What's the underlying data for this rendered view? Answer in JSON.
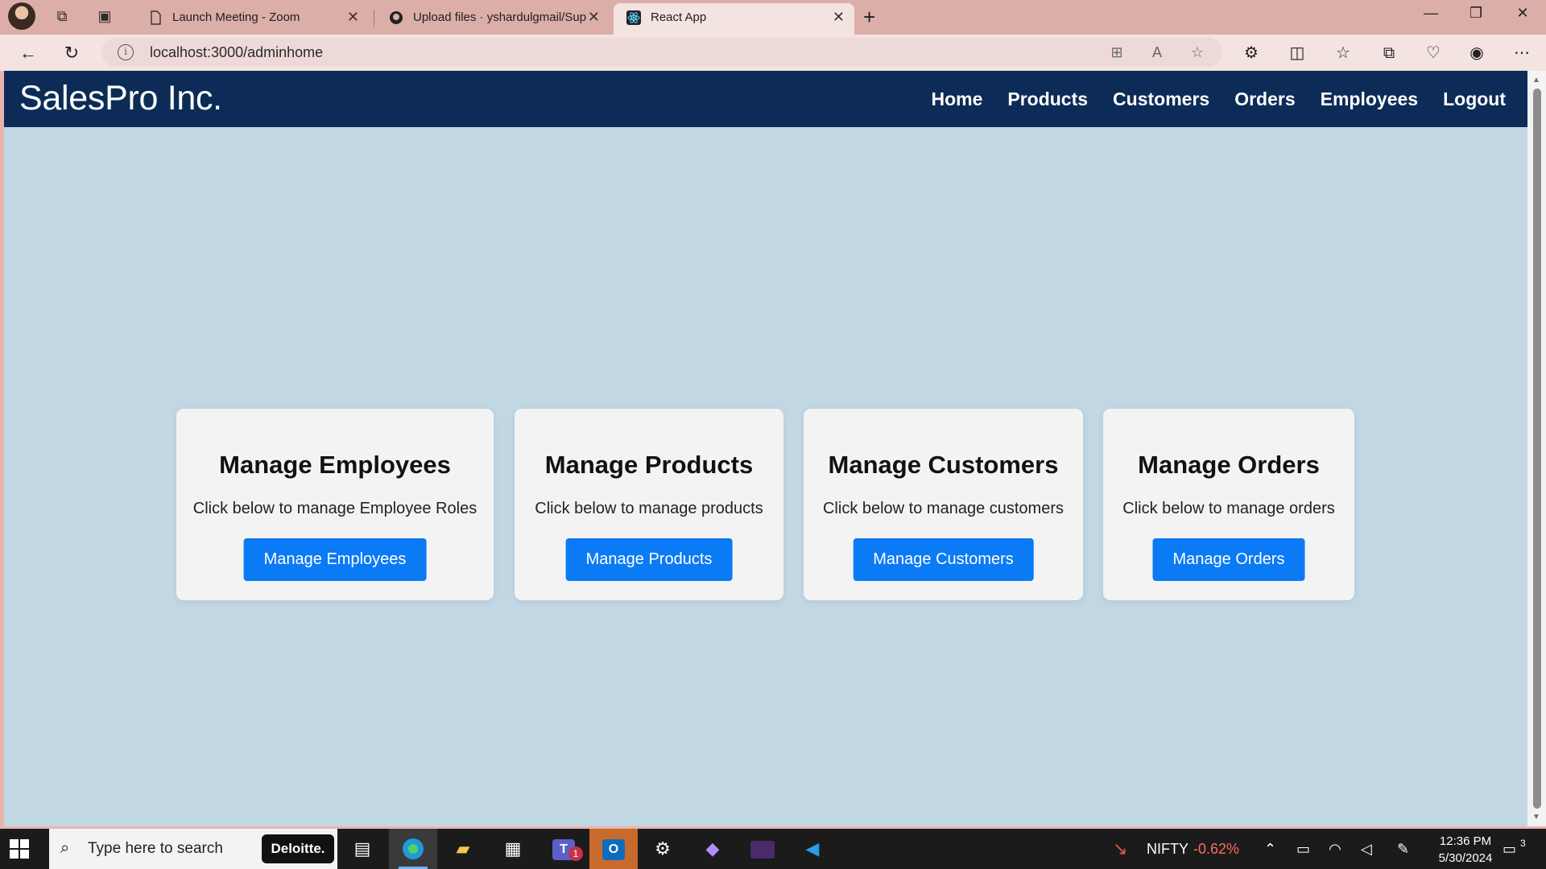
{
  "browser": {
    "tabs": [
      {
        "title": "Launch Meeting - Zoom",
        "icon": "document-icon",
        "active": false
      },
      {
        "title": "Upload files · yshardulgmail/Sup",
        "icon": "github-icon",
        "active": false
      },
      {
        "title": "React App",
        "icon": "react-icon",
        "active": true
      }
    ],
    "new_tab_label": "+",
    "url": "localhost:3000/adminhome"
  },
  "app": {
    "brand": "SalesPro Inc.",
    "nav": [
      "Home",
      "Products",
      "Customers",
      "Orders",
      "Employees",
      "Logout"
    ],
    "cards": [
      {
        "title": "Manage Employees",
        "description": "Click below to manage Employee Roles",
        "button": "Manage Employees"
      },
      {
        "title": "Manage Products",
        "description": "Click below to manage products",
        "button": "Manage Products"
      },
      {
        "title": "Manage Customers",
        "description": "Click below to manage customers",
        "button": "Manage Customers"
      },
      {
        "title": "Manage Orders",
        "description": "Click below to manage orders",
        "button": "Manage Orders"
      }
    ],
    "colors": {
      "navbar": "#0c2c57",
      "background": "#c2d7e4",
      "card": "#f3f3f3",
      "button": "#0b7af5"
    }
  },
  "taskbar": {
    "search_placeholder": "Type here to search",
    "search_brand": "Deloitte.",
    "teams_badge": "1",
    "stock_name": "NIFTY",
    "stock_change": "-0.62%",
    "time": "12:36 PM",
    "date": "5/30/2024",
    "notification_count": "3"
  }
}
